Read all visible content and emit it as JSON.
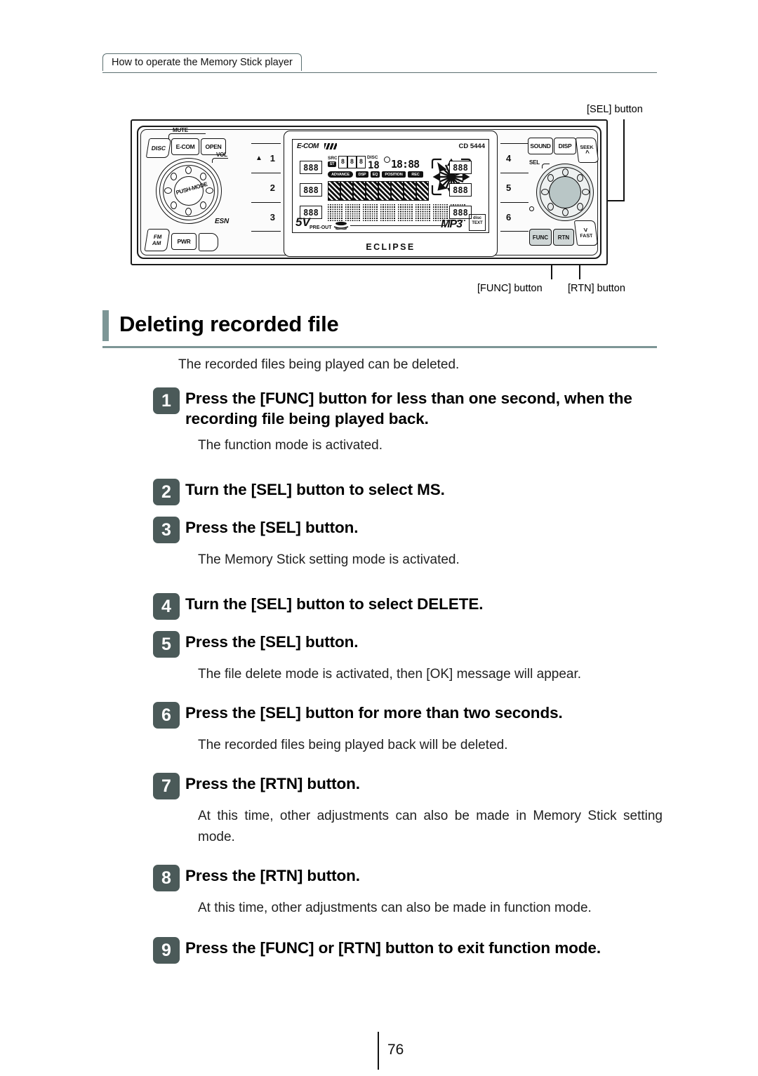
{
  "header": {
    "running_head": "How to operate the Memory Stick player"
  },
  "figure": {
    "callouts": [
      {
        "id": "sel",
        "label": "[SEL] button"
      },
      {
        "id": "func",
        "label": "[FUNC] button"
      },
      {
        "id": "rtn",
        "label": "[RTN] button"
      }
    ],
    "device": {
      "brand": "ECLIPSE",
      "model": "CD 5444",
      "left_buttons": [
        "DISC",
        "E-COM",
        "OPEN"
      ],
      "left_labels": [
        "MUTE",
        "VOL",
        "PUSH-MODE",
        "ESN"
      ],
      "bottom_left_buttons": [
        "FM\nAM",
        "PWR"
      ],
      "presets_left": [
        "1",
        "2",
        "3"
      ],
      "presets_right": [
        "4",
        "5",
        "6"
      ],
      "right_buttons": [
        "SOUND",
        "DISP",
        "SEEK"
      ],
      "right_labels": [
        "SEL"
      ],
      "bottom_right_buttons": [
        "FUNC",
        "RTN",
        "FAST"
      ],
      "lcd": {
        "brand_tag": "E-COM",
        "model_tag": "CD 5444",
        "indicator_src": "SRC",
        "indicator_st": "ST",
        "indicator_disc": "DISC",
        "disc_number": "18",
        "clock": "18:88",
        "tags": [
          "ADVANCE",
          "DSP",
          "EQ",
          "POSITION",
          "REC"
        ],
        "pre_out": "5V",
        "pre_out_sub": "PRE-OUT",
        "mp3": "MP3",
        "disc_text": "disc TEXT",
        "segments": [
          "888",
          "888",
          "888",
          "888",
          "888",
          "888"
        ]
      }
    }
  },
  "section": {
    "title": "Deleting recorded file",
    "intro": "The recorded files being played can be deleted."
  },
  "steps": [
    {
      "number": "1",
      "title": "Press the [FUNC] button for less than one second, when the recording file being played back.",
      "desc": "The function mode is activated.",
      "justify": false
    },
    {
      "number": "2",
      "title": "Turn the [SEL] button to select MS.",
      "desc": "",
      "justify": false
    },
    {
      "number": "3",
      "title": "Press the [SEL] button.",
      "desc": "The Memory Stick setting mode is activated.",
      "justify": false
    },
    {
      "number": "4",
      "title": "Turn the [SEL] button to select DELETE.",
      "desc": "",
      "justify": false
    },
    {
      "number": "5",
      "title": "Press the [SEL] button.",
      "desc": "The file delete mode is activated, then [OK] message will appear.",
      "justify": true
    },
    {
      "number": "6",
      "title": "Press the [SEL] button for more than two seconds.",
      "desc": "The recorded files being played back will be deleted.",
      "justify": false
    },
    {
      "number": "7",
      "title": "Press the [RTN] button.",
      "desc": "At this time, other adjustments can also be made in Memory Stick setting mode.",
      "justify": true
    },
    {
      "number": "8",
      "title": "Press the [RTN] button.",
      "desc": "At this time, other adjustments can also be made in function mode.",
      "justify": true
    },
    {
      "number": "9",
      "title": "Press the [FUNC] or [RTN] button to exit function mode.",
      "desc": "",
      "justify": false
    }
  ],
  "footer": {
    "page_number": "76"
  },
  "colors": {
    "accent": "#7d9696",
    "badge": "#4b5a59",
    "rule": "#5b6f70"
  }
}
